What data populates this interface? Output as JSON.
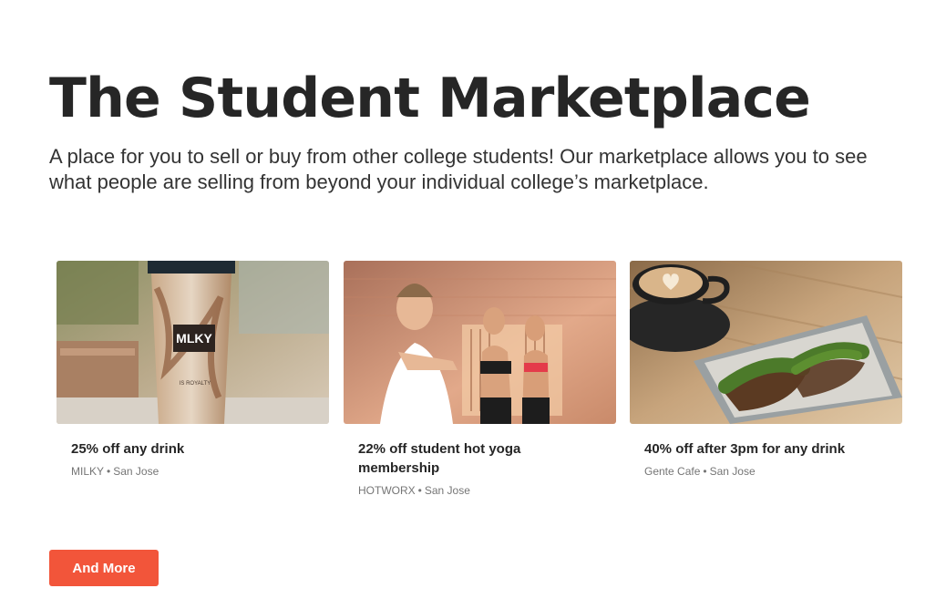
{
  "hero": {
    "title": "The Student Marketplace",
    "subtitle": "A place for you to sell or buy from other college students! Our marketplace allows you to see what people are selling from beyond your individual college’s marketplace."
  },
  "deals": [
    {
      "title": "25% off any drink",
      "vendor": "MILKY",
      "location": "San Jose",
      "photo_text": "MLKY",
      "photo_text2": "IS ROYALTY"
    },
    {
      "title": "22% off student hot yoga membership",
      "vendor": "HOTWORX",
      "location": "San Jose"
    },
    {
      "title": "40% off after 3pm for any drink",
      "vendor": "Gente Cafe",
      "location": "San Jose"
    }
  ],
  "separator": "•",
  "cta": {
    "label": "And More"
  },
  "colors": {
    "accent": "#f2553a",
    "text": "#262626",
    "muted": "#757575"
  }
}
